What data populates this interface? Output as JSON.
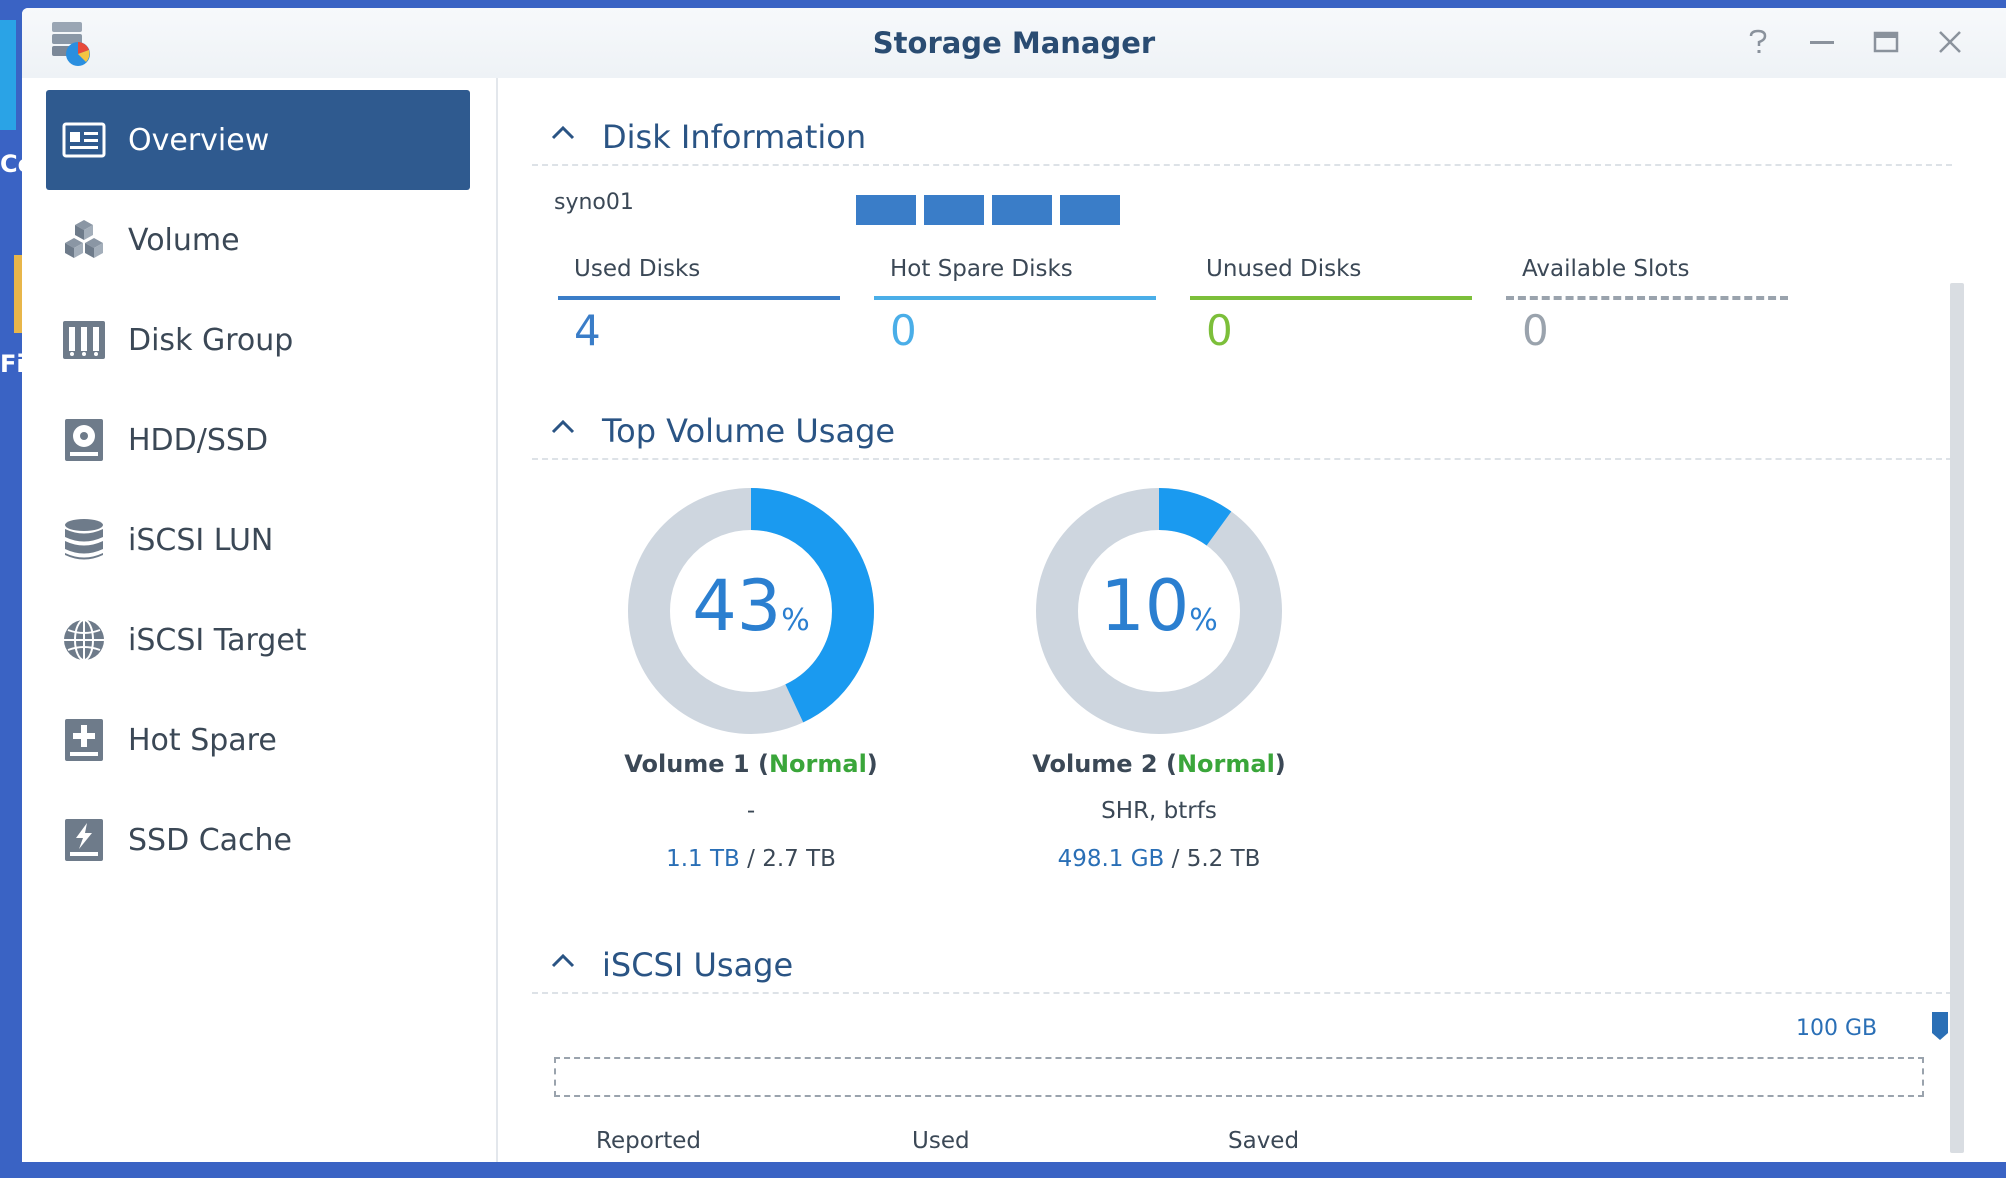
{
  "window": {
    "title": "Storage Manager",
    "controls": [
      "help",
      "minimize",
      "maximize",
      "close"
    ]
  },
  "desktop": {
    "label_1": "Co",
    "label_2": "Fi"
  },
  "sidebar": {
    "items": [
      {
        "label": "Overview",
        "icon": "overview-icon",
        "active": true
      },
      {
        "label": "Volume",
        "icon": "volume-cubes-icon",
        "active": false
      },
      {
        "label": "Disk Group",
        "icon": "disk-group-icon",
        "active": false
      },
      {
        "label": "HDD/SSD",
        "icon": "hdd-icon",
        "active": false
      },
      {
        "label": "iSCSI LUN",
        "icon": "database-icon",
        "active": false
      },
      {
        "label": "iSCSI Target",
        "icon": "globe-icon",
        "active": false
      },
      {
        "label": "Hot Spare",
        "icon": "hot-spare-plus-icon",
        "active": false
      },
      {
        "label": "SSD Cache",
        "icon": "ssd-cache-bolt-icon",
        "active": false
      }
    ]
  },
  "disk_info": {
    "title": "Disk Information",
    "host": "syno01",
    "disk_count": 4,
    "stats": [
      {
        "label": "Used Disks",
        "value": "4",
        "color": "#3a7dc8"
      },
      {
        "label": "Hot Spare Disks",
        "value": "0",
        "color": "#4aaee8"
      },
      {
        "label": "Unused Disks",
        "value": "0",
        "color": "#7cbf3a"
      },
      {
        "label": "Available Slots",
        "value": "0",
        "color": "#9aa3ad"
      }
    ]
  },
  "top_volume": {
    "title": "Top Volume Usage",
    "volumes": [
      {
        "percent": "43",
        "percent_sign": "%",
        "fraction": 0.43,
        "name": "Volume 1",
        "status": "Normal",
        "raid": "-",
        "used": "1.1 TB",
        "total": "2.7 TB"
      },
      {
        "percent": "10",
        "percent_sign": "%",
        "fraction": 0.1,
        "name": "Volume 2",
        "status": "Normal",
        "raid": "SHR, btrfs",
        "used": "498.1 GB",
        "total": "5.2 TB"
      }
    ]
  },
  "iscsi": {
    "title": "iSCSI Usage",
    "capacity": "100 GB",
    "columns": [
      "Reported",
      "Used",
      "Saved"
    ]
  },
  "colors": {
    "accent": "#2f5a8f",
    "donut_fill": "#1a9af0",
    "donut_track": "#ced6df",
    "status_normal": "#3aa63a"
  }
}
